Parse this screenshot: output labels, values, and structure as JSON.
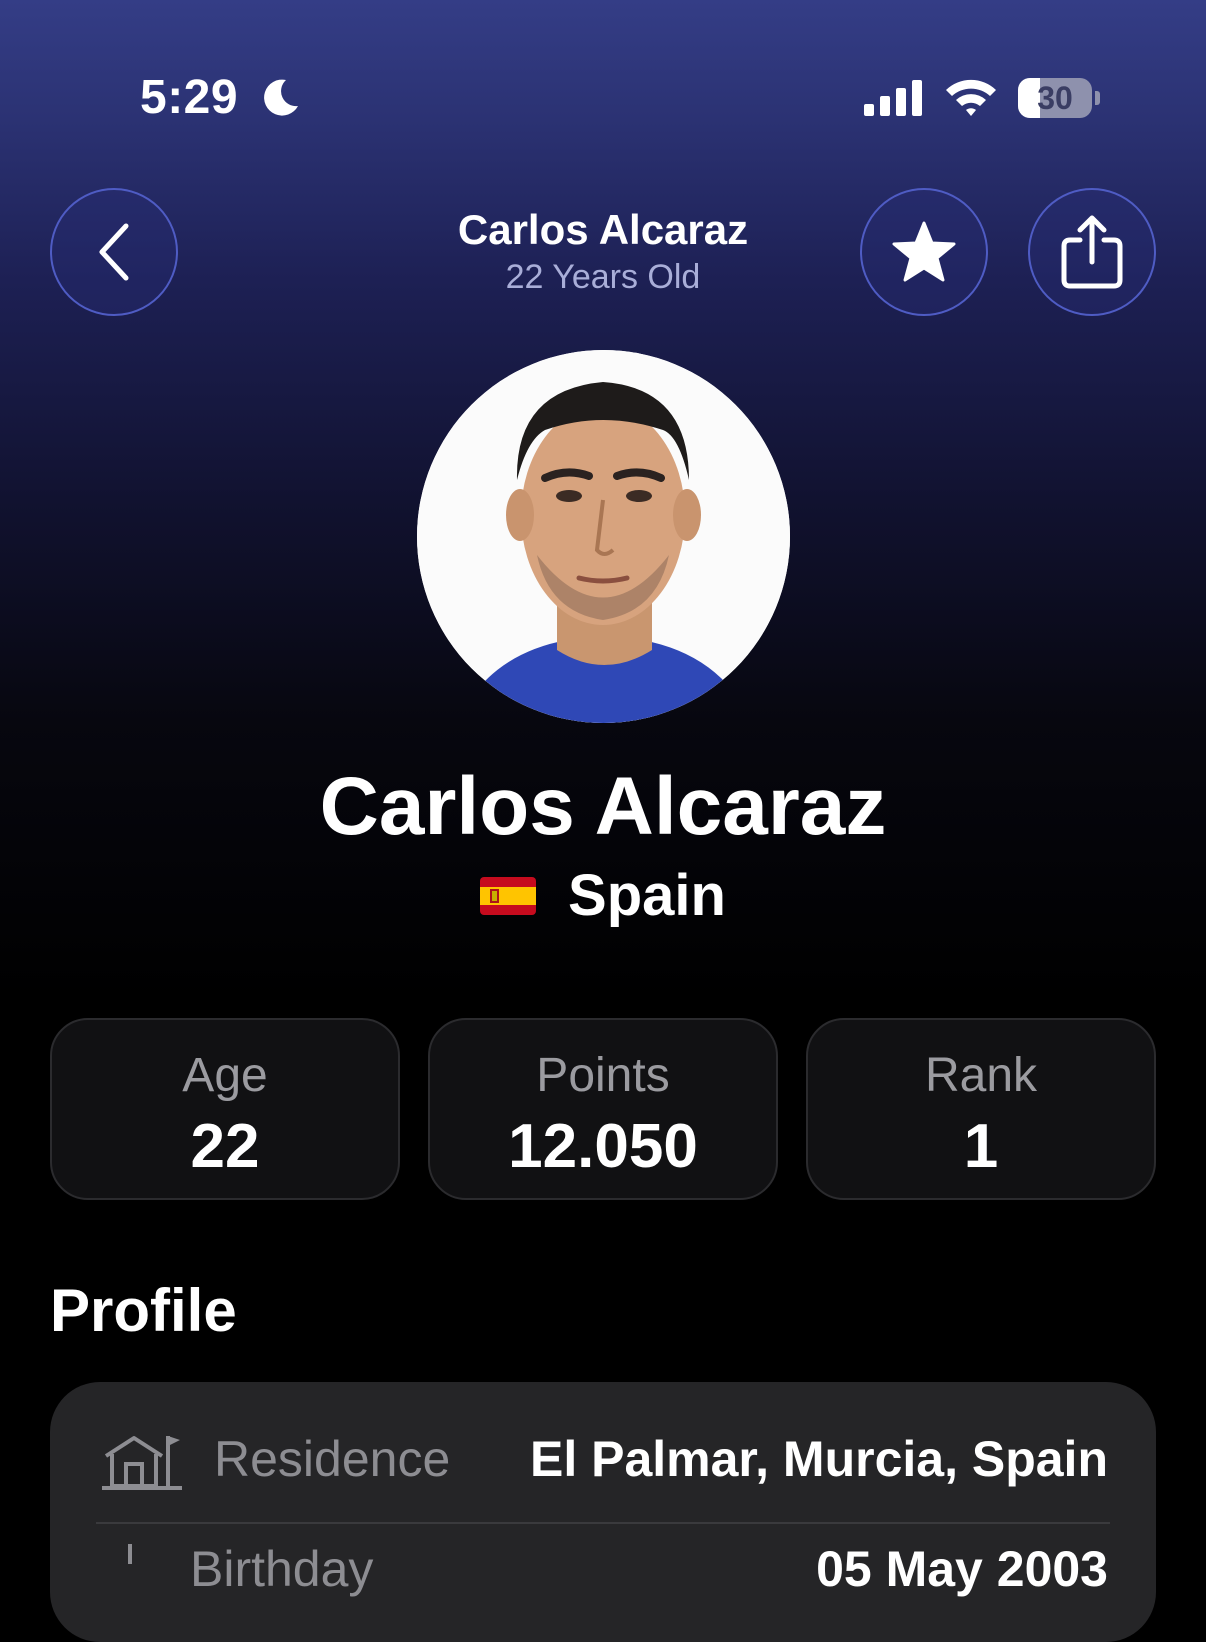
{
  "status_bar": {
    "time": "5:29",
    "battery_level": "30",
    "battery_fraction": 0.3,
    "icons": [
      "moon-icon",
      "signal-icon",
      "wifi-icon",
      "battery-icon"
    ]
  },
  "nav": {
    "title": "Carlos Alcaraz",
    "subtitle": "22 Years Old",
    "back_icon": "chevron-left-icon",
    "favorite_icon": "star-icon",
    "share_icon": "share-icon"
  },
  "player": {
    "name": "Carlos Alcaraz",
    "country": "Spain",
    "flag": "spain-flag"
  },
  "stats": [
    {
      "label": "Age",
      "value": "22"
    },
    {
      "label": "Points",
      "value": "12.050"
    },
    {
      "label": "Rank",
      "value": "1"
    }
  ],
  "profile": {
    "title": "Profile",
    "rows": [
      {
        "icon": "residence-icon",
        "label": "Residence",
        "value": "El Palmar, Murcia, Spain"
      },
      {
        "icon": "birth-icon",
        "label": "Birthday",
        "value": "05 May 2003"
      }
    ]
  },
  "colors": {
    "accent_border": "#4f5cc4",
    "gradient_top": "#343d86",
    "card_background": "#252527"
  }
}
